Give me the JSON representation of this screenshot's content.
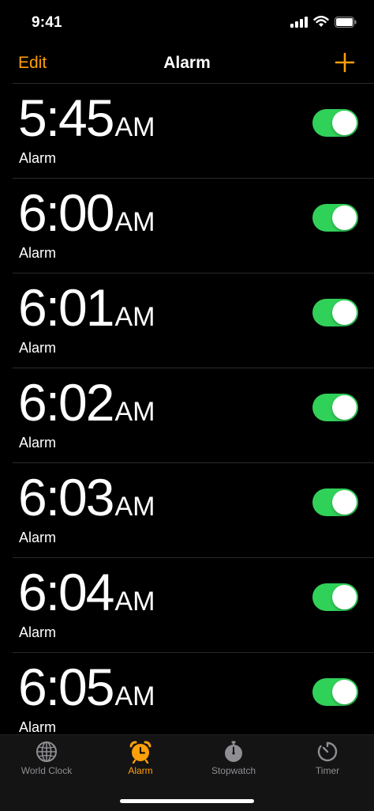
{
  "status_bar": {
    "time": "9:41"
  },
  "nav": {
    "edit_label": "Edit",
    "title": "Alarm"
  },
  "alarms": [
    {
      "time": "5:45",
      "ampm": "AM",
      "label": "Alarm",
      "enabled": true
    },
    {
      "time": "6:00",
      "ampm": "AM",
      "label": "Alarm",
      "enabled": true
    },
    {
      "time": "6:01",
      "ampm": "AM",
      "label": "Alarm",
      "enabled": true
    },
    {
      "time": "6:02",
      "ampm": "AM",
      "label": "Alarm",
      "enabled": true
    },
    {
      "time": "6:03",
      "ampm": "AM",
      "label": "Alarm",
      "enabled": true
    },
    {
      "time": "6:04",
      "ampm": "AM",
      "label": "Alarm",
      "enabled": true
    },
    {
      "time": "6:05",
      "ampm": "AM",
      "label": "Alarm",
      "enabled": true
    }
  ],
  "tabs": [
    {
      "label": "World Clock",
      "icon": "globe-icon",
      "active": false
    },
    {
      "label": "Alarm",
      "icon": "alarm-clock-icon",
      "active": true
    },
    {
      "label": "Stopwatch",
      "icon": "stopwatch-icon",
      "active": false
    },
    {
      "label": "Timer",
      "icon": "timer-icon",
      "active": false
    }
  ],
  "colors": {
    "accent": "#ff9f0a",
    "toggle_on": "#30d158",
    "background": "#000000",
    "inactive_tab": "#8e8e93"
  }
}
